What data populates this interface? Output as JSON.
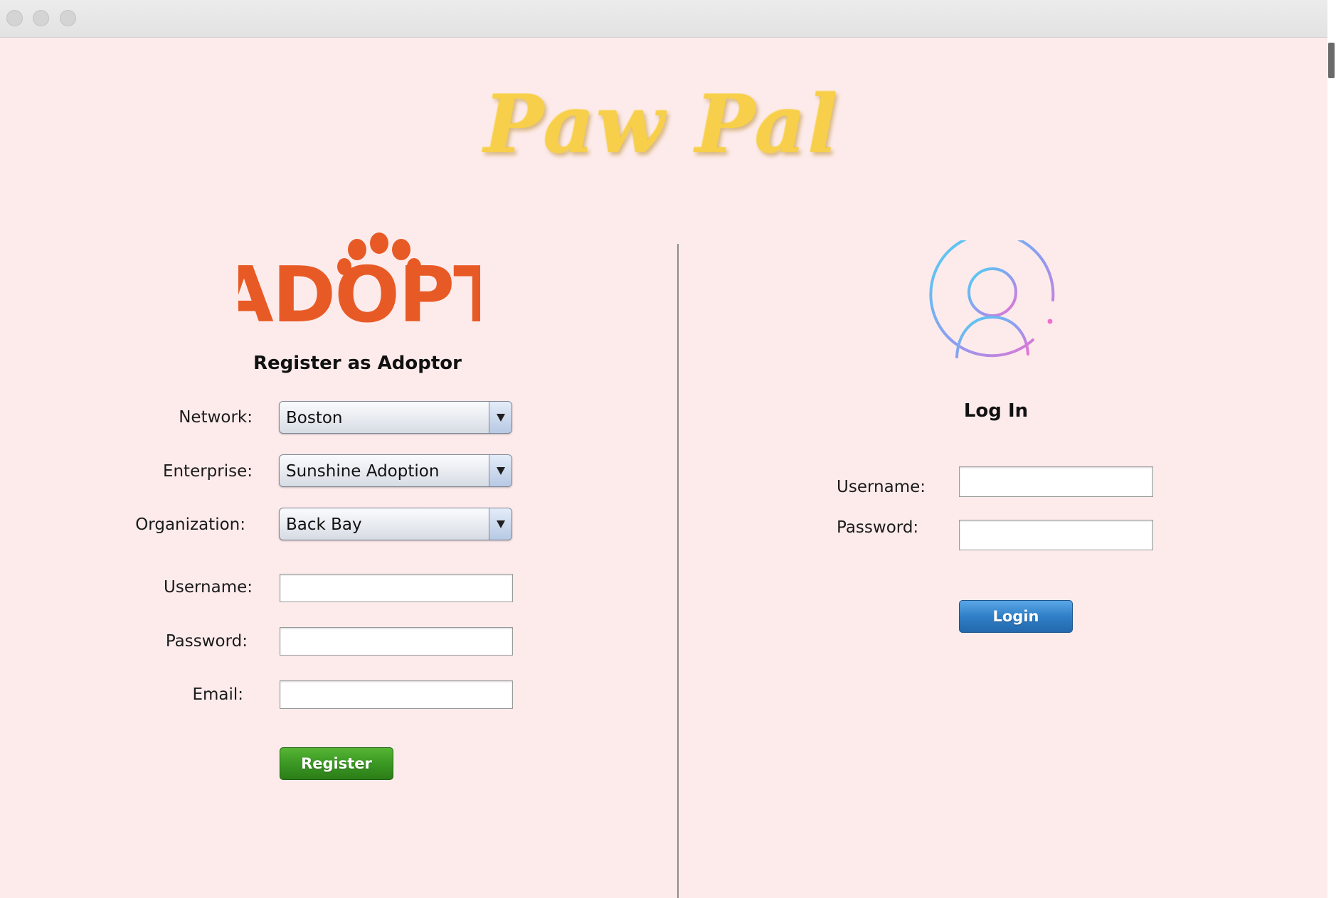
{
  "window": {
    "app_title": "Paw Pal"
  },
  "register": {
    "logo_text": "ADOPT",
    "title": "Register as Adoptor",
    "network_label": "Network:",
    "network_value": "Boston",
    "enterprise_label": "Enterprise:",
    "enterprise_value": "Sunshine Adoption",
    "organization_label": "Organization:",
    "organization_value": "Back Bay",
    "username_label": "Username:",
    "username_value": "",
    "password_label": "Password:",
    "password_value": "",
    "email_label": "Email:",
    "email_value": "",
    "register_button": "Register"
  },
  "login": {
    "avatar_icon": "user-avatar-icon",
    "title": "Log In",
    "username_label": "Username:",
    "username_value": "",
    "password_label": "Password:",
    "password_value": "",
    "login_button": "Login"
  },
  "colors": {
    "background": "#fdebeb",
    "title_yellow": "#f7cf4a",
    "adopt_orange": "#e85a25",
    "register_green": "#3a9823",
    "login_blue": "#2f7fc7"
  }
}
